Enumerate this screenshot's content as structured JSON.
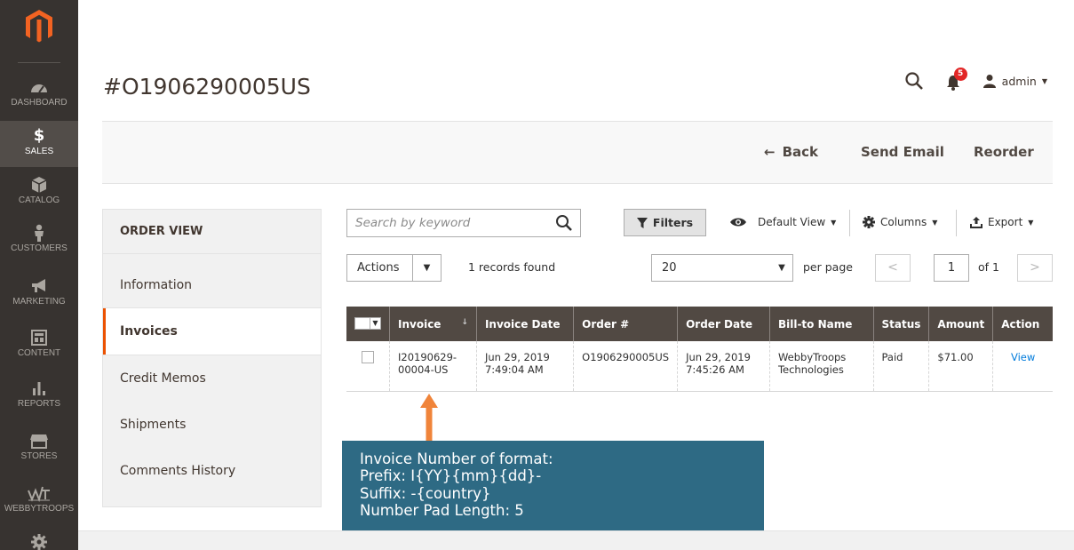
{
  "sidebar": {
    "items": [
      {
        "label": "DASHBOARD"
      },
      {
        "label": "SALES"
      },
      {
        "label": "CATALOG"
      },
      {
        "label": "CUSTOMERS"
      },
      {
        "label": "MARKETING"
      },
      {
        "label": "CONTENT"
      },
      {
        "label": "REPORTS"
      },
      {
        "label": "STORES"
      },
      {
        "label": "WEBBYTROOPS"
      }
    ]
  },
  "header": {
    "title": "#O1906290005US",
    "notification_count": "5",
    "user": "admin"
  },
  "action_bar": {
    "back": "Back",
    "send_email": "Send Email",
    "reorder": "Reorder"
  },
  "order_view": {
    "heading": "ORDER VIEW",
    "items": [
      "Information",
      "Invoices",
      "Credit Memos",
      "Shipments",
      "Comments History"
    ]
  },
  "toolbar": {
    "search_placeholder": "Search by keyword",
    "filters": "Filters",
    "default_view": "Default View",
    "columns": "Columns",
    "export": "Export",
    "actions": "Actions",
    "records_found": "1 records found",
    "per_page_value": "20",
    "per_page_label": "per page",
    "page": "1",
    "of_pages": "of 1"
  },
  "grid": {
    "columns": [
      "Invoice",
      "Invoice Date",
      "Order #",
      "Order Date",
      "Bill-to Name",
      "Status",
      "Amount",
      "Action"
    ],
    "rows": [
      {
        "invoice_1": "I20190629-",
        "invoice_2": "00004-US",
        "invoice_date_1": "Jun 29, 2019",
        "invoice_date_2": "7:49:04 AM",
        "order": "O1906290005US",
        "order_date_1": "Jun 29, 2019",
        "order_date_2": "7:45:26 AM",
        "bill_to_1": "WebbyTroops",
        "bill_to_2": "Technologies",
        "status": "Paid",
        "amount": "$71.00",
        "action": "View"
      }
    ]
  },
  "note": {
    "lines": [
      "Invoice Number of format:",
      "Prefix: I{YY}{mm}{dd}-",
      "Suffix: -{country}",
      "Number Pad Length: 5"
    ]
  },
  "colors": {
    "sidebar_bg": "#373330",
    "accent": "#eb5202",
    "grid_header": "#514943",
    "note_bg": "#2e6a84",
    "link": "#007bdb"
  }
}
